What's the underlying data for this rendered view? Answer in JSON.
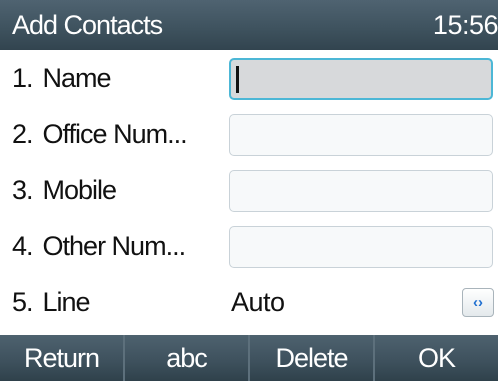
{
  "header": {
    "title": "Add Contacts",
    "time": "15:56"
  },
  "form": {
    "fields": [
      {
        "number": "1.",
        "label": "Name",
        "value": ""
      },
      {
        "number": "2.",
        "label": "Office Num...",
        "value": ""
      },
      {
        "number": "3.",
        "label": "Mobile",
        "value": ""
      },
      {
        "number": "4.",
        "label": "Other Num...",
        "value": ""
      },
      {
        "number": "5.",
        "label": "Line",
        "value": "Auto",
        "switch_icon": "left-right-arrows-icon"
      }
    ]
  },
  "softkeys": [
    "Return",
    "abc",
    "Delete",
    "OK"
  ],
  "colors": {
    "titlebar": "#3f535f",
    "active_field_border": "#4cb7d6",
    "arrow_icon": "#1f6fd0"
  }
}
